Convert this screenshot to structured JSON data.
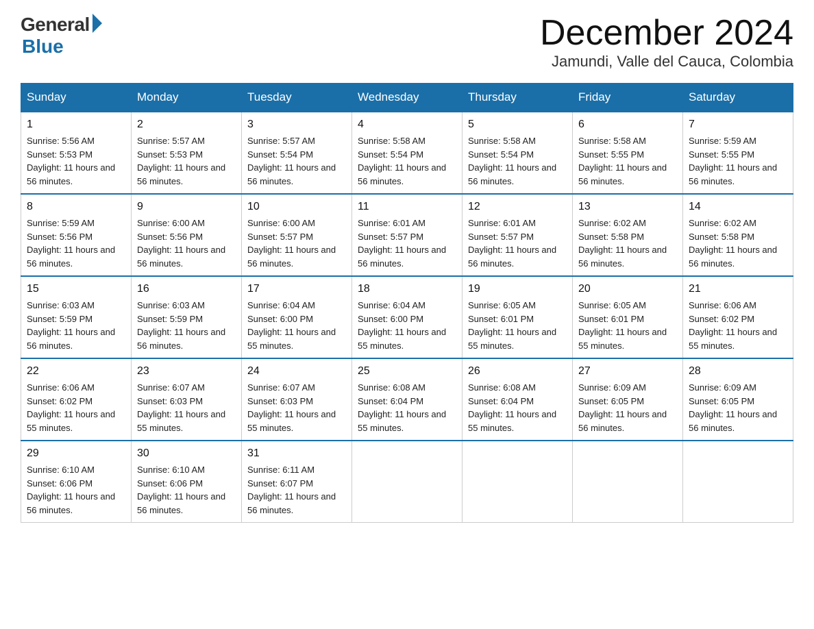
{
  "logo": {
    "general": "General",
    "blue": "Blue"
  },
  "header": {
    "month_year": "December 2024",
    "location": "Jamundi, Valle del Cauca, Colombia"
  },
  "days_of_week": [
    "Sunday",
    "Monday",
    "Tuesday",
    "Wednesday",
    "Thursday",
    "Friday",
    "Saturday"
  ],
  "weeks": [
    [
      {
        "day": "1",
        "sunrise": "Sunrise: 5:56 AM",
        "sunset": "Sunset: 5:53 PM",
        "daylight": "Daylight: 11 hours and 56 minutes."
      },
      {
        "day": "2",
        "sunrise": "Sunrise: 5:57 AM",
        "sunset": "Sunset: 5:53 PM",
        "daylight": "Daylight: 11 hours and 56 minutes."
      },
      {
        "day": "3",
        "sunrise": "Sunrise: 5:57 AM",
        "sunset": "Sunset: 5:54 PM",
        "daylight": "Daylight: 11 hours and 56 minutes."
      },
      {
        "day": "4",
        "sunrise": "Sunrise: 5:58 AM",
        "sunset": "Sunset: 5:54 PM",
        "daylight": "Daylight: 11 hours and 56 minutes."
      },
      {
        "day": "5",
        "sunrise": "Sunrise: 5:58 AM",
        "sunset": "Sunset: 5:54 PM",
        "daylight": "Daylight: 11 hours and 56 minutes."
      },
      {
        "day": "6",
        "sunrise": "Sunrise: 5:58 AM",
        "sunset": "Sunset: 5:55 PM",
        "daylight": "Daylight: 11 hours and 56 minutes."
      },
      {
        "day": "7",
        "sunrise": "Sunrise: 5:59 AM",
        "sunset": "Sunset: 5:55 PM",
        "daylight": "Daylight: 11 hours and 56 minutes."
      }
    ],
    [
      {
        "day": "8",
        "sunrise": "Sunrise: 5:59 AM",
        "sunset": "Sunset: 5:56 PM",
        "daylight": "Daylight: 11 hours and 56 minutes."
      },
      {
        "day": "9",
        "sunrise": "Sunrise: 6:00 AM",
        "sunset": "Sunset: 5:56 PM",
        "daylight": "Daylight: 11 hours and 56 minutes."
      },
      {
        "day": "10",
        "sunrise": "Sunrise: 6:00 AM",
        "sunset": "Sunset: 5:57 PM",
        "daylight": "Daylight: 11 hours and 56 minutes."
      },
      {
        "day": "11",
        "sunrise": "Sunrise: 6:01 AM",
        "sunset": "Sunset: 5:57 PM",
        "daylight": "Daylight: 11 hours and 56 minutes."
      },
      {
        "day": "12",
        "sunrise": "Sunrise: 6:01 AM",
        "sunset": "Sunset: 5:57 PM",
        "daylight": "Daylight: 11 hours and 56 minutes."
      },
      {
        "day": "13",
        "sunrise": "Sunrise: 6:02 AM",
        "sunset": "Sunset: 5:58 PM",
        "daylight": "Daylight: 11 hours and 56 minutes."
      },
      {
        "day": "14",
        "sunrise": "Sunrise: 6:02 AM",
        "sunset": "Sunset: 5:58 PM",
        "daylight": "Daylight: 11 hours and 56 minutes."
      }
    ],
    [
      {
        "day": "15",
        "sunrise": "Sunrise: 6:03 AM",
        "sunset": "Sunset: 5:59 PM",
        "daylight": "Daylight: 11 hours and 56 minutes."
      },
      {
        "day": "16",
        "sunrise": "Sunrise: 6:03 AM",
        "sunset": "Sunset: 5:59 PM",
        "daylight": "Daylight: 11 hours and 56 minutes."
      },
      {
        "day": "17",
        "sunrise": "Sunrise: 6:04 AM",
        "sunset": "Sunset: 6:00 PM",
        "daylight": "Daylight: 11 hours and 55 minutes."
      },
      {
        "day": "18",
        "sunrise": "Sunrise: 6:04 AM",
        "sunset": "Sunset: 6:00 PM",
        "daylight": "Daylight: 11 hours and 55 minutes."
      },
      {
        "day": "19",
        "sunrise": "Sunrise: 6:05 AM",
        "sunset": "Sunset: 6:01 PM",
        "daylight": "Daylight: 11 hours and 55 minutes."
      },
      {
        "day": "20",
        "sunrise": "Sunrise: 6:05 AM",
        "sunset": "Sunset: 6:01 PM",
        "daylight": "Daylight: 11 hours and 55 minutes."
      },
      {
        "day": "21",
        "sunrise": "Sunrise: 6:06 AM",
        "sunset": "Sunset: 6:02 PM",
        "daylight": "Daylight: 11 hours and 55 minutes."
      }
    ],
    [
      {
        "day": "22",
        "sunrise": "Sunrise: 6:06 AM",
        "sunset": "Sunset: 6:02 PM",
        "daylight": "Daylight: 11 hours and 55 minutes."
      },
      {
        "day": "23",
        "sunrise": "Sunrise: 6:07 AM",
        "sunset": "Sunset: 6:03 PM",
        "daylight": "Daylight: 11 hours and 55 minutes."
      },
      {
        "day": "24",
        "sunrise": "Sunrise: 6:07 AM",
        "sunset": "Sunset: 6:03 PM",
        "daylight": "Daylight: 11 hours and 55 minutes."
      },
      {
        "day": "25",
        "sunrise": "Sunrise: 6:08 AM",
        "sunset": "Sunset: 6:04 PM",
        "daylight": "Daylight: 11 hours and 55 minutes."
      },
      {
        "day": "26",
        "sunrise": "Sunrise: 6:08 AM",
        "sunset": "Sunset: 6:04 PM",
        "daylight": "Daylight: 11 hours and 55 minutes."
      },
      {
        "day": "27",
        "sunrise": "Sunrise: 6:09 AM",
        "sunset": "Sunset: 6:05 PM",
        "daylight": "Daylight: 11 hours and 56 minutes."
      },
      {
        "day": "28",
        "sunrise": "Sunrise: 6:09 AM",
        "sunset": "Sunset: 6:05 PM",
        "daylight": "Daylight: 11 hours and 56 minutes."
      }
    ],
    [
      {
        "day": "29",
        "sunrise": "Sunrise: 6:10 AM",
        "sunset": "Sunset: 6:06 PM",
        "daylight": "Daylight: 11 hours and 56 minutes."
      },
      {
        "day": "30",
        "sunrise": "Sunrise: 6:10 AM",
        "sunset": "Sunset: 6:06 PM",
        "daylight": "Daylight: 11 hours and 56 minutes."
      },
      {
        "day": "31",
        "sunrise": "Sunrise: 6:11 AM",
        "sunset": "Sunset: 6:07 PM",
        "daylight": "Daylight: 11 hours and 56 minutes."
      },
      null,
      null,
      null,
      null
    ]
  ]
}
